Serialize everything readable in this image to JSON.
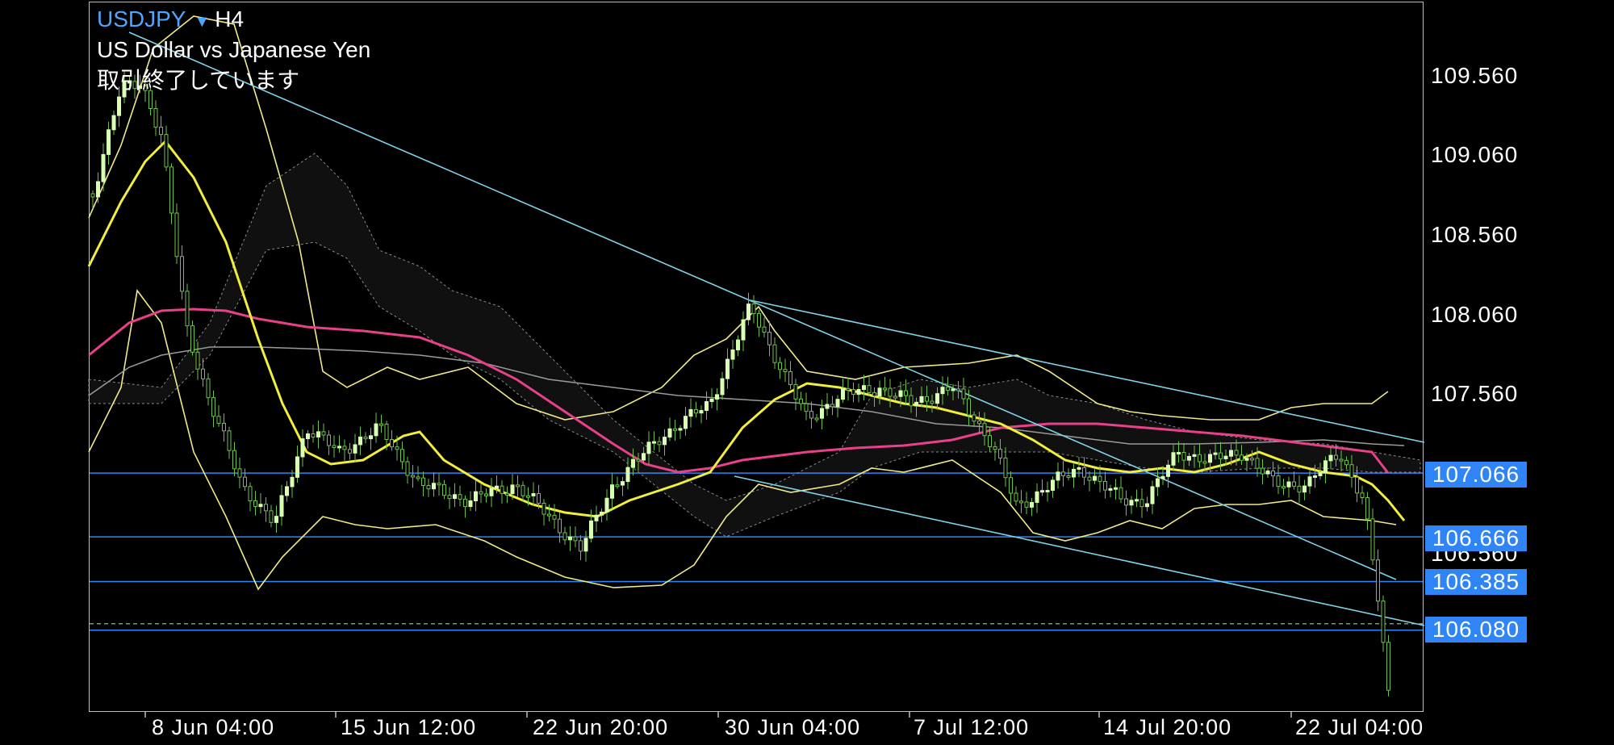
{
  "header": {
    "symbol": "USDJPY",
    "timeframe": "H4",
    "description": "US Dollar vs Japanese Yen",
    "status": "取引終了しています"
  },
  "price_axis": {
    "ticks": [
      "109.560",
      "109.060",
      "108.560",
      "108.060",
      "107.560",
      "106.560"
    ]
  },
  "price_labels": [
    "107.066",
    "106.666",
    "106.385",
    "106.080"
  ],
  "time_axis": {
    "ticks": [
      "8 Jun 04:00",
      "15 Jun 12:00",
      "22 Jun 20:00",
      "30 Jun 04:00",
      "7 Jul 12:00",
      "14 Jul 20:00",
      "22 Jul 04:00"
    ]
  },
  "colors": {
    "background": "#000000",
    "frame": "#bfbfbf",
    "candles": "#d9ffb3",
    "ma_fast": "#f2ee3a",
    "ma_slow": "#e8408a",
    "ma_long": "#9a9a9a",
    "bollinger": "#f0ea8a",
    "trendline": "#7fd3e8",
    "horizontal_lines": "#2f85f5",
    "price_label_bg": "#2f85f5",
    "symbol": "#4da6ff"
  },
  "chart_data": {
    "type": "candlestick",
    "symbol": "USDJPY",
    "timeframe": "H4",
    "x": [
      "8 Jun 04:00",
      "15 Jun 12:00",
      "22 Jun 20:00",
      "30 Jun 04:00",
      "7 Jul 12:00",
      "14 Jul 20:00",
      "22 Jul 04:00"
    ],
    "ylim": [
      105.55,
      110.05
    ],
    "y_ticks": [
      109.56,
      109.06,
      108.56,
      108.06,
      107.56,
      106.56
    ],
    "horizontal_levels": [
      107.066,
      106.666,
      106.385,
      106.08
    ],
    "close_approx": 106.12,
    "grid": false
  }
}
